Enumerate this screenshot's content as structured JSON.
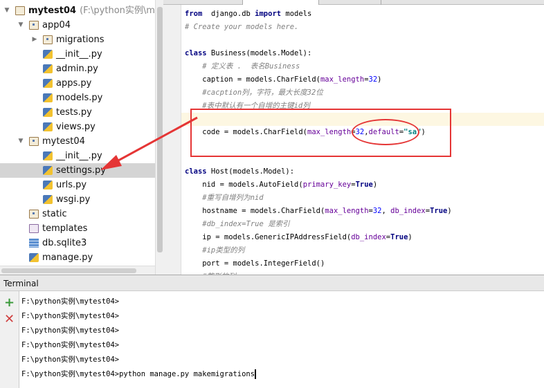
{
  "project_tree": {
    "root": {
      "label": "mytest04",
      "path": "(F:\\python实例\\mytes"
    },
    "items": [
      {
        "label": "app04",
        "type": "pkg",
        "depth": 1,
        "expanded": true
      },
      {
        "label": "migrations",
        "type": "pkg",
        "depth": 2,
        "expanded": false
      },
      {
        "label": "__init__.py",
        "type": "py",
        "depth": 2
      },
      {
        "label": "admin.py",
        "type": "py",
        "depth": 2
      },
      {
        "label": "apps.py",
        "type": "py",
        "depth": 2
      },
      {
        "label": "models.py",
        "type": "py",
        "depth": 2
      },
      {
        "label": "tests.py",
        "type": "py",
        "depth": 2
      },
      {
        "label": "views.py",
        "type": "py",
        "depth": 2
      },
      {
        "label": "mytest04",
        "type": "pkg",
        "depth": 1,
        "expanded": true
      },
      {
        "label": "__init__.py",
        "type": "py",
        "depth": 2
      },
      {
        "label": "settings.py",
        "type": "py",
        "depth": 2,
        "selected": true
      },
      {
        "label": "urls.py",
        "type": "py",
        "depth": 2
      },
      {
        "label": "wsgi.py",
        "type": "py",
        "depth": 2
      },
      {
        "label": "static",
        "type": "pkg",
        "depth": 1
      },
      {
        "label": "templates",
        "type": "tpl",
        "depth": 1
      },
      {
        "label": "db.sqlite3",
        "type": "db",
        "depth": 1
      },
      {
        "label": "manage.py",
        "type": "py",
        "depth": 1
      }
    ]
  },
  "editor": {
    "highlight_line": 8,
    "lines": [
      [
        [
          "kw",
          "from"
        ],
        [
          "",
          "  django.db "
        ],
        [
          "kw",
          "import"
        ],
        [
          "",
          " models"
        ]
      ],
      [
        [
          "cm",
          "# Create your models here."
        ]
      ],
      [],
      [
        [
          "kw",
          "class"
        ],
        [
          "",
          " Business(models.Model):"
        ]
      ],
      [
        [
          "cm",
          "    # 定义表 .  表名Business"
        ]
      ],
      [
        [
          "",
          "    caption = models.CharField("
        ],
        [
          "pa",
          "max_length"
        ],
        [
          "",
          "="
        ],
        [
          "nu",
          "32"
        ],
        [
          "",
          ")"
        ]
      ],
      [
        [
          "cm",
          "    #cacption列，字符，最大长度32位"
        ]
      ],
      [
        [
          "cm",
          "    #表中默认有一个自增的主键id列"
        ]
      ],
      [],
      [
        [
          "",
          "    code = models.CharField("
        ],
        [
          "pa",
          "max_length"
        ],
        [
          "",
          "="
        ],
        [
          "nu",
          "32"
        ],
        [
          "",
          ","
        ],
        [
          "pa",
          "default"
        ],
        [
          "",
          "="
        ],
        [
          "st",
          "\"sa\""
        ],
        [
          "",
          ")"
        ]
      ],
      [],
      [],
      [
        [
          "kw",
          "class"
        ],
        [
          "",
          " Host(models.Model):"
        ]
      ],
      [
        [
          "",
          "    nid = models.AutoField("
        ],
        [
          "pa",
          "primary_key"
        ],
        [
          "",
          "="
        ],
        [
          "kw",
          "True"
        ],
        [
          "",
          ")"
        ]
      ],
      [
        [
          "cm",
          "    #重写自增列为nid"
        ]
      ],
      [
        [
          "",
          "    hostname = models.CharField("
        ],
        [
          "pa",
          "max_length"
        ],
        [
          "",
          "="
        ],
        [
          "nu",
          "32"
        ],
        [
          "",
          ", "
        ],
        [
          "pa",
          "db_index"
        ],
        [
          "",
          "="
        ],
        [
          "kw",
          "True"
        ],
        [
          "",
          ")"
        ]
      ],
      [
        [
          "cm",
          "    #db_index=True 是索引"
        ]
      ],
      [
        [
          "",
          "    ip = models.GenericIPAddressField("
        ],
        [
          "pa",
          "db_index"
        ],
        [
          "",
          "="
        ],
        [
          "kw",
          "True"
        ],
        [
          "",
          ")"
        ]
      ],
      [
        [
          "cm",
          "    #ip类型的列"
        ]
      ],
      [
        [
          "",
          "    port = models.IntegerField()"
        ]
      ],
      [
        [
          "cm",
          "    #整形的列"
        ]
      ]
    ]
  },
  "terminal": {
    "title": "Terminal",
    "add_icon": "plus-icon",
    "close_icon": "close-icon",
    "lines": [
      "F:\\python实例\\mytest04>",
      "F:\\python实例\\mytest04>",
      "F:\\python实例\\mytest04>",
      "F:\\python实例\\mytest04>",
      "F:\\python实例\\mytest04>",
      "F:\\python实例\\mytest04>python manage.py makemigrations"
    ]
  },
  "annotation_color": "#e53535"
}
